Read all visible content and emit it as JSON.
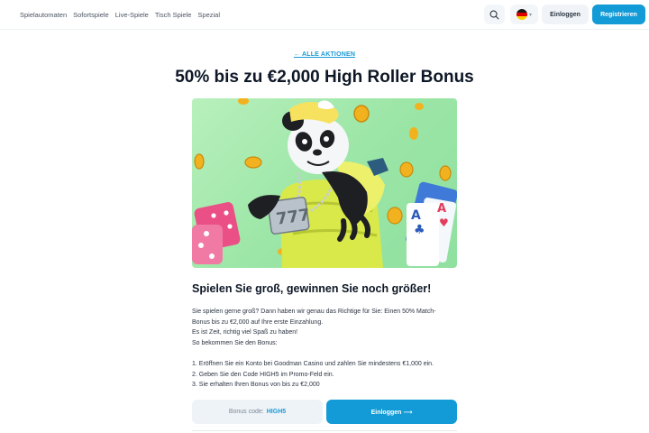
{
  "nav": {
    "items": [
      "Spielautomaten",
      "Sofortspiele",
      "Live-Spiele",
      "Tisch Spiele",
      "Spezial"
    ]
  },
  "header": {
    "search_icon": "search-icon",
    "language_flag": "flag-germany-icon",
    "login_label": "Einloggen",
    "register_label": "Registrieren"
  },
  "promo": {
    "back_link": "← ALLE AKTIONEN",
    "title": "50% bis zu €2,000 High Roller Bonus",
    "subtitle": "Spielen Sie groß, gewinnen Sie noch größer!",
    "intro_lines": [
      "Sie spielen gerne groß? Dann haben wir genau das Richtige für Sie: Einen 50% Match-",
      "Bonus bis zu €2,000 auf Ihre erste Einzahlung.",
      "Es ist Zeit, richtig viel Spaß zu haben!",
      "So bekommen Sie den Bonus:"
    ],
    "steps": [
      "Eröffnen Sie ein Konto bei Goodman Casino und zahlen Sie mindestens €1,000 ein.",
      "Geben Sie den Code HIGH5 im Promo-Feld ein.",
      "Sie erhalten Ihren Bonus von bis zu €2,000"
    ],
    "bonus_code_label": "Bonus code:",
    "bonus_code_value": "HIGH5",
    "login_label": "Einloggen ⟶"
  },
  "colors": {
    "accent": "#129bd6",
    "hero_background": "#a8ebb0"
  }
}
